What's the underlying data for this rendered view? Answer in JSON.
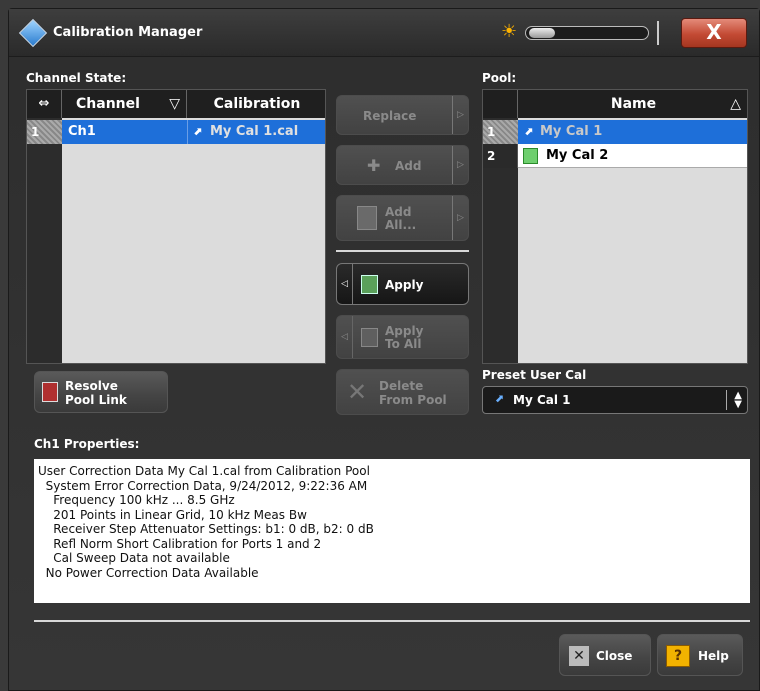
{
  "window": {
    "title": "Calibration Manager",
    "close_glyph": "X"
  },
  "channel_state": {
    "label": "Channel State:",
    "columns": {
      "corner_glyph": "⇔",
      "channel": "Channel",
      "channel_sort": "▽",
      "calibration": "Calibration"
    },
    "rows": [
      {
        "num": "1",
        "channel": "Ch1",
        "calibration": "My Cal 1.cal"
      }
    ]
  },
  "pool": {
    "label": "Pool:",
    "columns": {
      "name": "Name",
      "sort": "△"
    },
    "rows": [
      {
        "num": "1",
        "name": "My Cal 1"
      },
      {
        "num": "2",
        "name": "My Cal 2"
      }
    ]
  },
  "buttons": {
    "replace": "Replace",
    "add": "Add",
    "add_all_1": "Add",
    "add_all_2": "All...",
    "apply": "Apply",
    "apply_to_all_1": "Apply",
    "apply_to_all_2": "To All",
    "delete_1": "Delete",
    "delete_2": "From Pool",
    "resolve_1": "Resolve",
    "resolve_2": "Pool Link",
    "close": "Close",
    "help": "Help"
  },
  "preset_user_cal": {
    "label": "Preset User Cal",
    "value": "My Cal 1"
  },
  "properties": {
    "label": "Ch1 Properties:",
    "lines": [
      "User Correction Data My Cal 1.cal from Calibration Pool",
      "  System Error Correction Data, 9/24/2012, 9:22:36 AM",
      "    Frequency 100 kHz ... 8.5 GHz",
      "    201 Points in Linear Grid, 10 kHz Meas Bw",
      "    Receiver Step Attenuator Settings: b1: 0 dB, b2: 0 dB",
      "    Refl Norm Short Calibration for Ports 1 and 2",
      "    Cal Sweep Data not available",
      "  No Power Correction Data Available"
    ]
  },
  "colors": {
    "selection": "#1e6fd9",
    "close_button": "#c34a34",
    "background": "#333333"
  }
}
